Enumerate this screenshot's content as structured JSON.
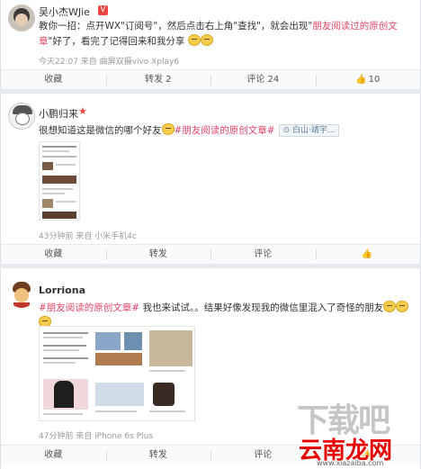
{
  "posts": [
    {
      "username": "吴小杰WJie",
      "text_parts": [
        "教你一招：点开WX\"订阅号\"，然后点击右上角\"查找\"，就会出现\"",
        "朋友阅读过的原创文章",
        "\"好了，看完了记得回来和我分享"
      ],
      "meta": "今天22:07 来自 曲屏双摄vivo Xplay6",
      "actions": [
        "收藏",
        "转发 2",
        "评论 24",
        "10"
      ]
    },
    {
      "username": "小鹏归来",
      "text_parts": [
        "很想知道这是微信的哪个好友",
        "#朋友阅读的原创文章#"
      ],
      "location": "白山·靖宇...",
      "meta": "43分钟前 来自 小米手机4c",
      "actions": [
        "收藏",
        "转发",
        "评论",
        ""
      ]
    },
    {
      "username": "Lorriona",
      "text_parts": [
        "#朋友阅读的原创文章#",
        " 我也来试试。。结果好像发现我的微信里混入了奇怪的朋友"
      ],
      "meta": "47分钟前 来自 iPhone 6s Plus",
      "actions": [
        "收藏",
        "转发",
        "评论",
        ""
      ]
    }
  ],
  "watermark": {
    "top": "下载吧",
    "bottom": "云南龙网",
    "url": "www.xiazaiba.com"
  },
  "icons": [
    "avatar-1",
    "avatar-2",
    "avatar-3",
    "v-badge",
    "star-icon",
    "emoji-icon",
    "location-icon",
    "thumbs-up-icon"
  ]
}
